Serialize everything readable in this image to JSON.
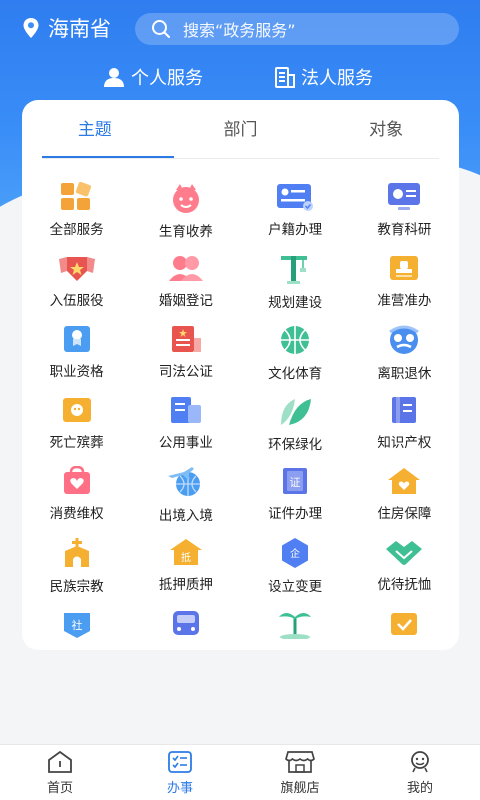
{
  "header": {
    "location": "海南省",
    "search_placeholder": "搜索“政务服务”"
  },
  "service_tabs": [
    {
      "label": "个人服务",
      "icon": "person-icon"
    },
    {
      "label": "法人服务",
      "icon": "building-icon"
    }
  ],
  "category_tabs": [
    {
      "label": "主题",
      "active": true
    },
    {
      "label": "部门",
      "active": false
    },
    {
      "label": "对象",
      "active": false
    }
  ],
  "items": [
    {
      "label": "全部服务",
      "icon": "grid-icon"
    },
    {
      "label": "生育收养",
      "icon": "baby-icon"
    },
    {
      "label": "户籍办理",
      "icon": "id-card-icon"
    },
    {
      "label": "教育科研",
      "icon": "monitor-icon"
    },
    {
      "label": "入伍服役",
      "icon": "army-icon"
    },
    {
      "label": "婚姻登记",
      "icon": "couple-icon"
    },
    {
      "label": "规划建设",
      "icon": "crane-icon"
    },
    {
      "label": "准营准办",
      "icon": "stamp-icon"
    },
    {
      "label": "职业资格",
      "icon": "certificate-icon"
    },
    {
      "label": "司法公证",
      "icon": "notary-icon"
    },
    {
      "label": "文化体育",
      "icon": "ball-icon"
    },
    {
      "label": "离职退休",
      "icon": "retiree-icon"
    },
    {
      "label": "死亡殡葬",
      "icon": "funeral-icon"
    },
    {
      "label": "公用事业",
      "icon": "utility-icon"
    },
    {
      "label": "环保绿化",
      "icon": "leaf-icon"
    },
    {
      "label": "知识产权",
      "icon": "book-icon"
    },
    {
      "label": "消费维权",
      "icon": "bag-heart-icon"
    },
    {
      "label": "出境入境",
      "icon": "plane-globe-icon"
    },
    {
      "label": "证件办理",
      "icon": "zheng-icon"
    },
    {
      "label": "住房保障",
      "icon": "house-icon"
    },
    {
      "label": "民族宗教",
      "icon": "church-icon"
    },
    {
      "label": "抵押质押",
      "icon": "di-house-icon"
    },
    {
      "label": "设立变更",
      "icon": "qi-hexagon-icon"
    },
    {
      "label": "优待抚恤",
      "icon": "handshake-icon"
    },
    {
      "label": "",
      "icon": "she-icon"
    },
    {
      "label": "",
      "icon": "bus-icon"
    },
    {
      "label": "",
      "icon": "palm-tree-icon"
    },
    {
      "label": "",
      "icon": "check-box-icon"
    }
  ],
  "bottom_nav": [
    {
      "label": "首页",
      "icon": "home-icon",
      "active": false
    },
    {
      "label": "办事",
      "icon": "task-icon",
      "active": true
    },
    {
      "label": "旗舰店",
      "icon": "store-icon",
      "active": false
    },
    {
      "label": "我的",
      "icon": "profile-icon",
      "active": false
    }
  ],
  "colors": {
    "primary": "#2c7be5",
    "hero": "#3a8ef7"
  }
}
